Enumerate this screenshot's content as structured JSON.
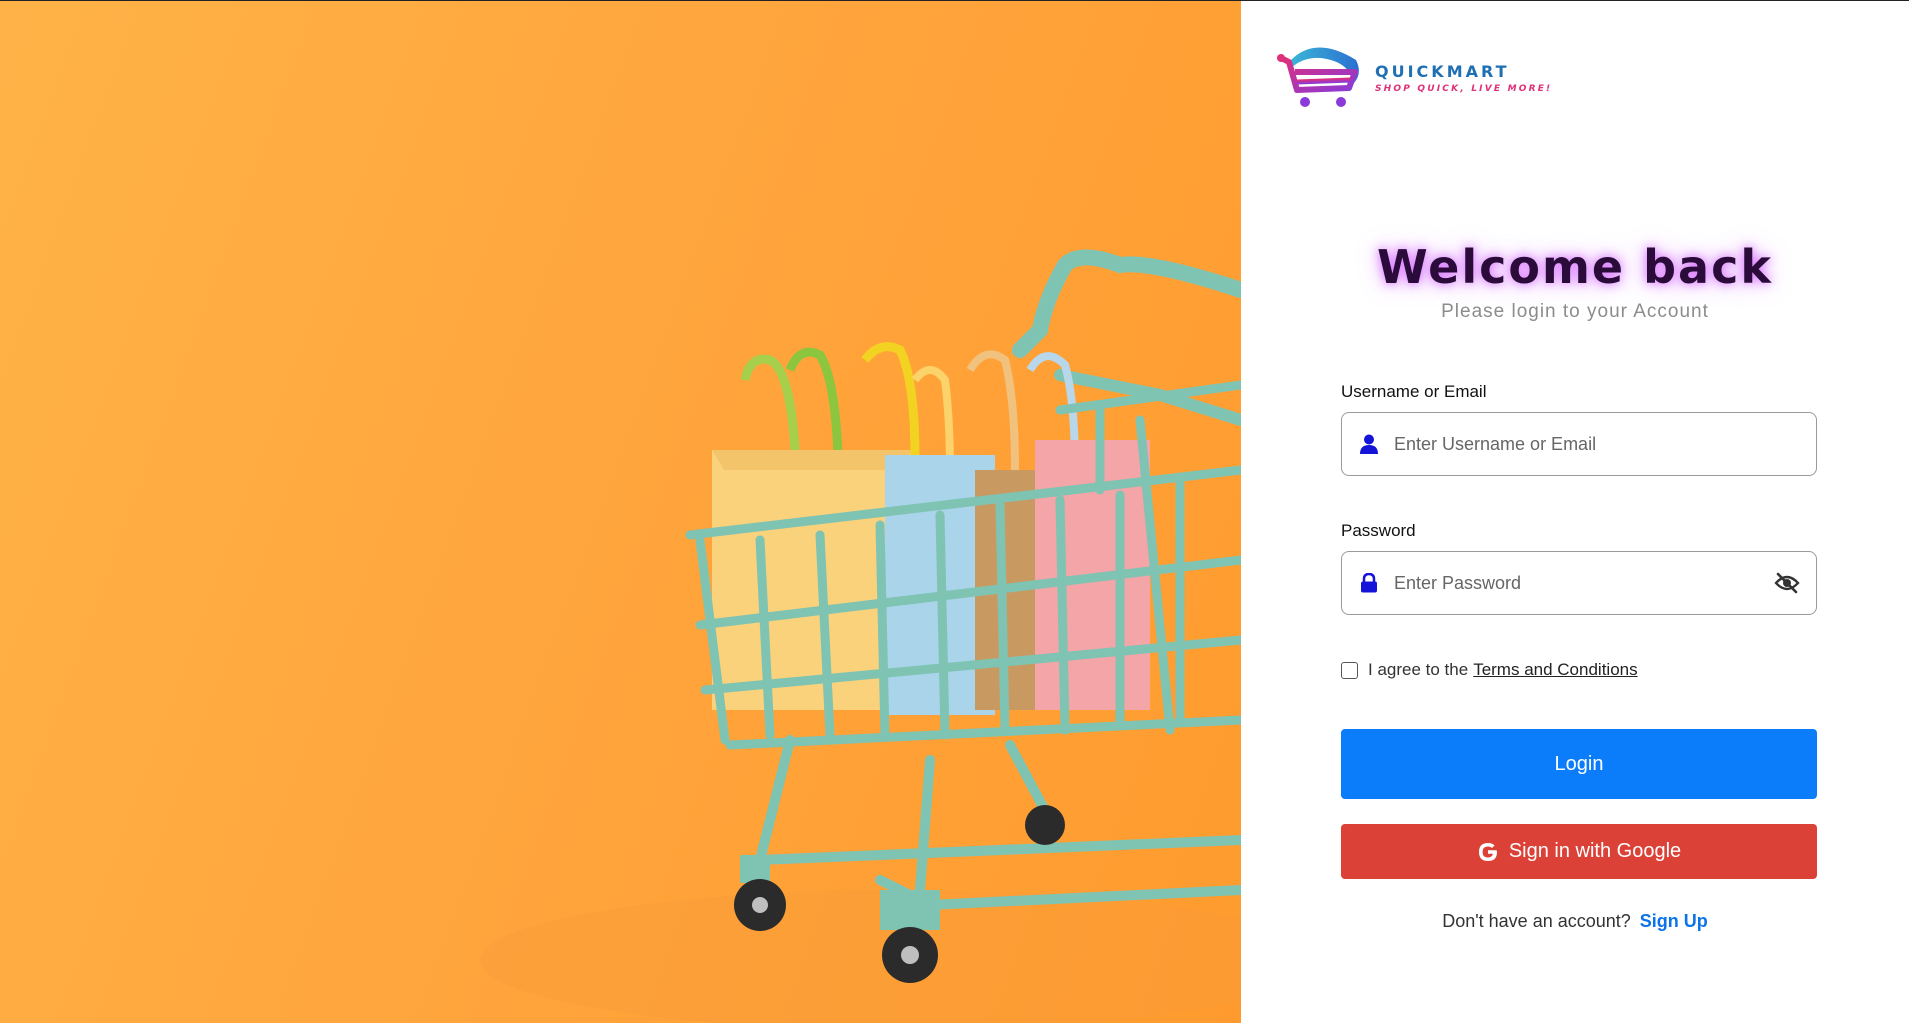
{
  "brand": {
    "name": "QUICKMART",
    "tagline": "SHOP QUICK, LIVE MORE!"
  },
  "login": {
    "title": "Welcome back",
    "subtitle": "Please login to your Account",
    "username_label": "Username or Email",
    "username_placeholder": "Enter Username or Email",
    "username_value": "",
    "password_label": "Password",
    "password_placeholder": "Enter Password",
    "password_value": "",
    "agree_prefix": "I agree to the",
    "terms_link": "Terms and Conditions",
    "agree_checked": false,
    "login_button": "Login",
    "google_button": "Sign in with Google",
    "signup_prompt": "Don't have an account?",
    "signup_link": "Sign Up"
  },
  "icons": {
    "username": "user-icon",
    "password": "lock-icon",
    "toggle": "eye-slash-icon",
    "google": "google-icon"
  },
  "colors": {
    "login_button": "#0b7dfb",
    "google_button": "#dc4137",
    "signup_link": "#0b74e8",
    "hero_background": "#ffa63e",
    "cart": "#7fc3b3"
  }
}
